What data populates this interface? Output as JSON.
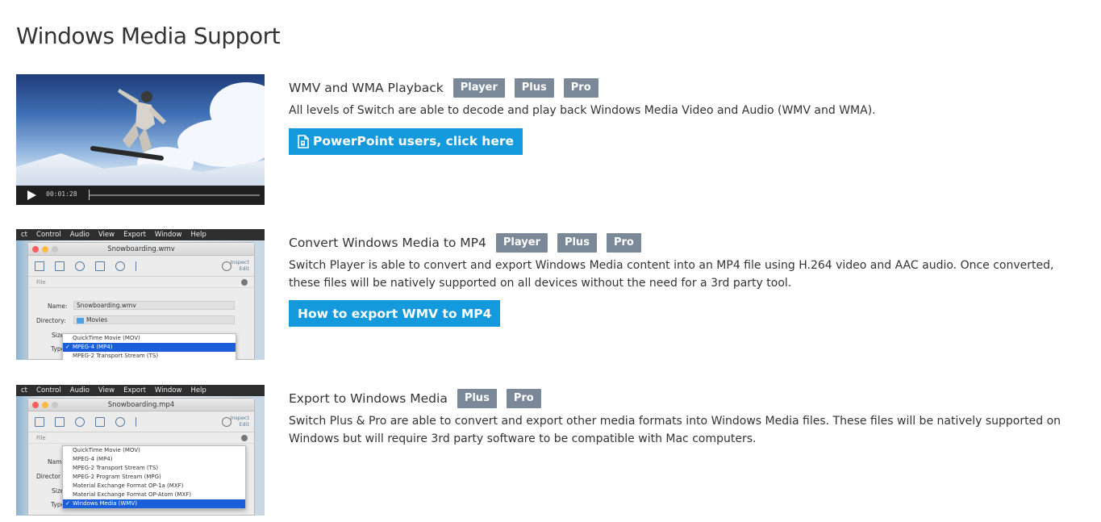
{
  "page": {
    "title": "Windows Media Support"
  },
  "colors": {
    "badge": "#7a8898",
    "button": "#1599dd",
    "text": "#333333"
  },
  "features": [
    {
      "title": "WMV and WMA Playback",
      "badges": [
        "Player",
        "Plus",
        "Pro"
      ],
      "description": "All levels of Switch are able to decode and play back Windows Media Video and Audio (WMV and WMA).",
      "button": {
        "label": "PowerPoint users, click here",
        "icon": "document-icon"
      },
      "thumb": {
        "type": "video",
        "time": "00:01:28"
      }
    },
    {
      "title": "Convert Windows Media to MP4",
      "badges": [
        "Player",
        "Plus",
        "Pro"
      ],
      "description": "Switch Player is able to convert and export Windows Media content into an MP4 file using H.264 video and AAC audio. Once converted, these files will be natively supported on all devices without the need for a 3rd party tool.",
      "button": {
        "label": "How to export WMV to MP4"
      },
      "thumb": {
        "type": "app",
        "menu": [
          "ct",
          "Control",
          "Audio",
          "View",
          "Export",
          "Window",
          "Help"
        ],
        "window_title": "Snowboarding.wmv",
        "inspect": "Inspect",
        "edit": "Edit",
        "section": "File",
        "name_label": "Name:",
        "name_value": "Snowboarding.wmv",
        "directory_label": "Directory:",
        "directory_value": "Movies",
        "size_label": "Size",
        "type_label": "Type",
        "options": [
          "QuickTime Movie (MOV)",
          "MPEG-4 (MP4)",
          "MPEG-2 Transport Stream (TS)"
        ],
        "selected_option": "MPEG-4 (MP4)"
      }
    },
    {
      "title": "Export to Windows Media",
      "badges": [
        "Plus",
        "Pro"
      ],
      "description": "Switch Plus & Pro are able to convert and export other media formats into Windows Media files. These files will be natively supported on Windows but will require 3rd party software to be compatible with Mac computers.",
      "thumb": {
        "type": "app",
        "menu": [
          "ct",
          "Control",
          "Audio",
          "View",
          "Export",
          "Window",
          "Help"
        ],
        "window_title": "Snowboarding.mp4",
        "inspect": "Inspect",
        "edit": "Edit",
        "section": "File",
        "name_label": "Name",
        "directory_label": "Director",
        "size_label": "Size",
        "type_label": "Type",
        "options": [
          "QuickTime Movie (MOV)",
          "MPEG-4 (MP4)",
          "MPEG-2 Transport Stream (TS)",
          "MPEG-2 Program Stream (MPG)",
          "Material Exchange Format OP-1a (MXF)",
          "Material Exchange Format OP-Atom (MXF)",
          "Windows Media (WMV)"
        ],
        "selected_option": "Windows Media (WMV)"
      }
    }
  ]
}
